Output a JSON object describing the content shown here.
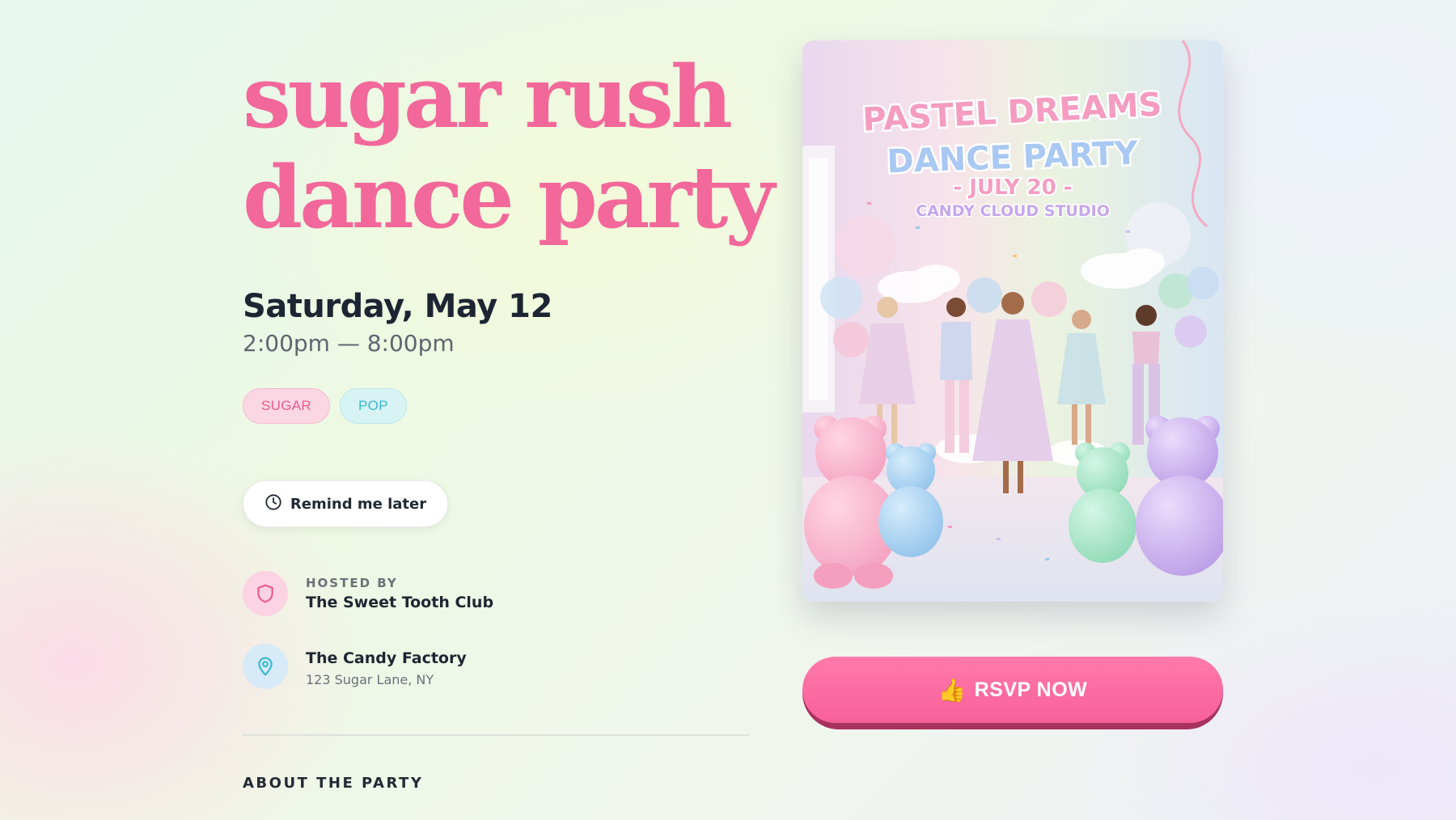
{
  "event": {
    "title_line1": "sugar rush",
    "title_line2": "dance party",
    "date": "Saturday, May 12",
    "time": "2:00pm — 8:00pm"
  },
  "tags": [
    "SUGAR",
    "POP"
  ],
  "remind_button": {
    "label": "Remind me later",
    "icon": "clock-icon"
  },
  "host": {
    "eyebrow": "HOSTED BY",
    "name": "The Sweet Tooth Club",
    "icon": "shield-icon"
  },
  "venue": {
    "name": "The Candy Factory",
    "address": "123 Sugar Lane, NY",
    "icon": "map-pin-icon"
  },
  "about": {
    "heading": "ABOUT THE PARTY"
  },
  "poster": {
    "line1": "PASTEL DREAMS",
    "line2": "DANCE PARTY",
    "date": "- JULY 20 -",
    "venue": "CANDY CLOUD STUDIO"
  },
  "rsvp_button": {
    "label": "RSVP NOW",
    "icon": "thumbs-up-icon"
  },
  "colors": {
    "title": "#f2689a",
    "rsvp": "#f7609a",
    "sugar_tag": "#ea5b8d",
    "pop_tag": "#38b9d2"
  }
}
